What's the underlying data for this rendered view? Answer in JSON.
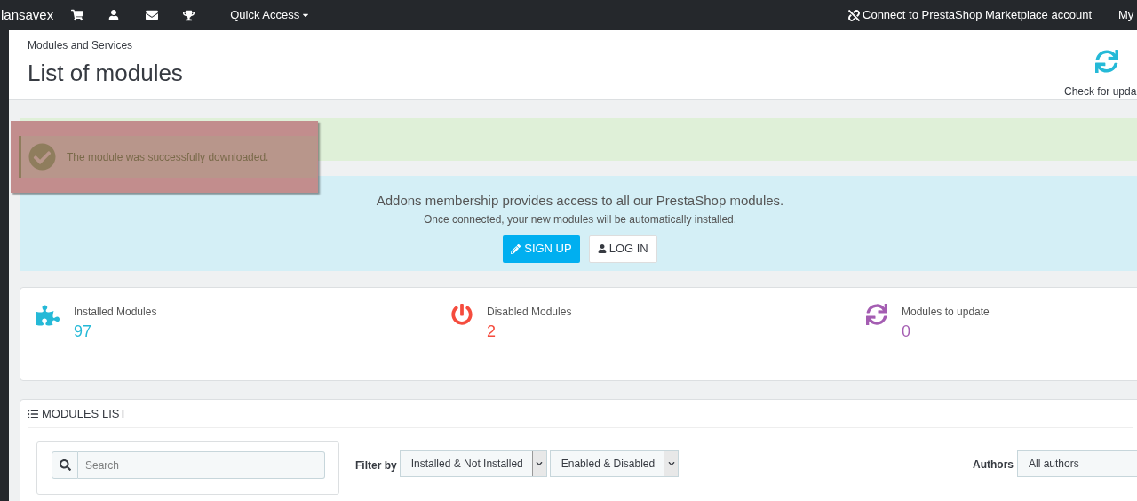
{
  "topbar": {
    "brand": "lansavex",
    "quick_access": "Quick Access",
    "marketplace": "Connect to PrestaShop Marketplace account",
    "account": "My"
  },
  "header": {
    "breadcrumb": "Modules and Services",
    "title": "List of modules",
    "toolbar_button": "Check for upda"
  },
  "toast": {
    "message": "The module was successfully downloaded."
  },
  "addons": {
    "headline": "Addons membership provides access to all our PrestaShop modules.",
    "subline": "Once connected, your new modules will be automatically installed.",
    "buttons": [
      {
        "kind": "primary",
        "label": "SIGN UP"
      },
      {
        "kind": "default",
        "label": "LOG IN"
      }
    ]
  },
  "stats": [
    {
      "kind": "installed",
      "label": "Installed Modules",
      "value": "97",
      "color": "#25b9d7"
    },
    {
      "kind": "disabled",
      "label": "Disabled Modules",
      "value": "2",
      "color": "#f54c3e"
    },
    {
      "kind": "update",
      "label": "Modules to update",
      "value": "0",
      "color": "#a45db2"
    }
  ],
  "modules_list": {
    "title": "MODULES LIST",
    "search": {
      "placeholder": "Search"
    },
    "filter_label": "Filter by",
    "filters": [
      "Installed & Not Installed",
      "Enabled & Disabled"
    ],
    "authors_label": "Authors",
    "authors_value": "All authors"
  }
}
